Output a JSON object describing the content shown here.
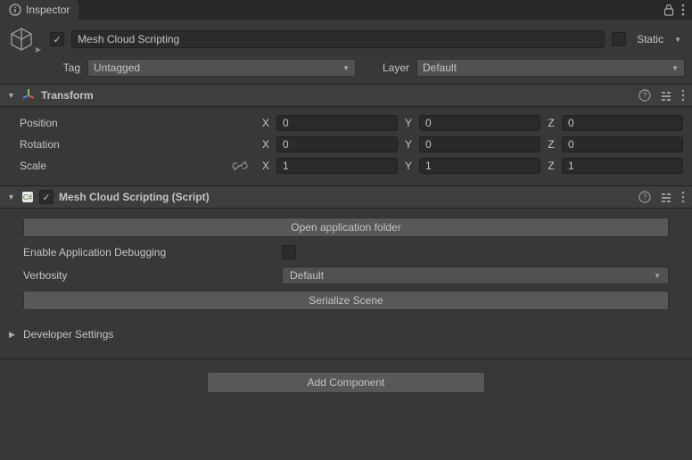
{
  "tab": {
    "title": "Inspector"
  },
  "gameObject": {
    "name": "Mesh Cloud Scripting",
    "staticLabel": "Static",
    "tagLabel": "Tag",
    "tagValue": "Untagged",
    "layerLabel": "Layer",
    "layerValue": "Default"
  },
  "transform": {
    "title": "Transform",
    "position": {
      "label": "Position",
      "x": "0",
      "y": "0",
      "z": "0"
    },
    "rotation": {
      "label": "Rotation",
      "x": "0",
      "y": "0",
      "z": "0"
    },
    "scale": {
      "label": "Scale",
      "x": "1",
      "y": "1",
      "z": "1"
    },
    "axisX": "X",
    "axisY": "Y",
    "axisZ": "Z"
  },
  "script": {
    "title": "Mesh Cloud Scripting (Script)",
    "openFolder": "Open application folder",
    "enableDebugLabel": "Enable Application Debugging",
    "verbosityLabel": "Verbosity",
    "verbosityValue": "Default",
    "serialize": "Serialize Scene"
  },
  "developer": {
    "title": "Developer Settings"
  },
  "addComponent": "Add Component"
}
